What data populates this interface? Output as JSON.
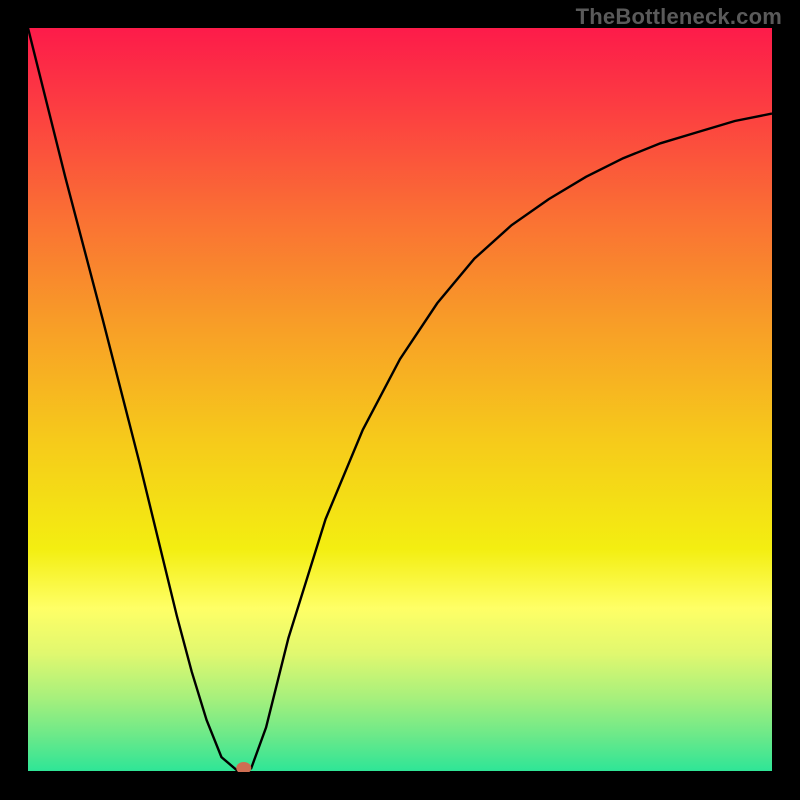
{
  "watermark": "TheBottleneck.com",
  "chart_data": {
    "type": "line",
    "title": "",
    "xlabel": "",
    "ylabel": "",
    "xlim": [
      0,
      1
    ],
    "ylim": [
      0,
      1
    ],
    "series": [
      {
        "name": "curve",
        "x": [
          0.0,
          0.05,
          0.1,
          0.15,
          0.2,
          0.22,
          0.24,
          0.26,
          0.28,
          0.29,
          0.3,
          0.32,
          0.35,
          0.4,
          0.45,
          0.5,
          0.55,
          0.6,
          0.65,
          0.7,
          0.75,
          0.8,
          0.85,
          0.9,
          0.95,
          1.0
        ],
        "y": [
          1.0,
          0.8,
          0.61,
          0.415,
          0.21,
          0.135,
          0.07,
          0.02,
          0.003,
          0.0,
          0.005,
          0.06,
          0.18,
          0.34,
          0.46,
          0.555,
          0.63,
          0.69,
          0.735,
          0.77,
          0.8,
          0.825,
          0.845,
          0.86,
          0.875,
          0.885
        ]
      }
    ],
    "marker": {
      "x": 0.29,
      "y": 0.0,
      "color": "#cf6e52"
    },
    "background": {
      "type": "vertical-gradient",
      "stops": [
        {
          "pos": 0.0,
          "color": "#fd1b4a"
        },
        {
          "pos": 0.1,
          "color": "#fc3b42"
        },
        {
          "pos": 0.25,
          "color": "#fa6f34"
        },
        {
          "pos": 0.4,
          "color": "#f89e27"
        },
        {
          "pos": 0.55,
          "color": "#f6c91b"
        },
        {
          "pos": 0.7,
          "color": "#f3ee11"
        },
        {
          "pos": 0.78,
          "color": "#ffff66"
        },
        {
          "pos": 0.84,
          "color": "#e1f86f"
        },
        {
          "pos": 0.9,
          "color": "#a7f07c"
        },
        {
          "pos": 0.95,
          "color": "#6de989"
        },
        {
          "pos": 1.0,
          "color": "#2de597"
        }
      ]
    }
  }
}
